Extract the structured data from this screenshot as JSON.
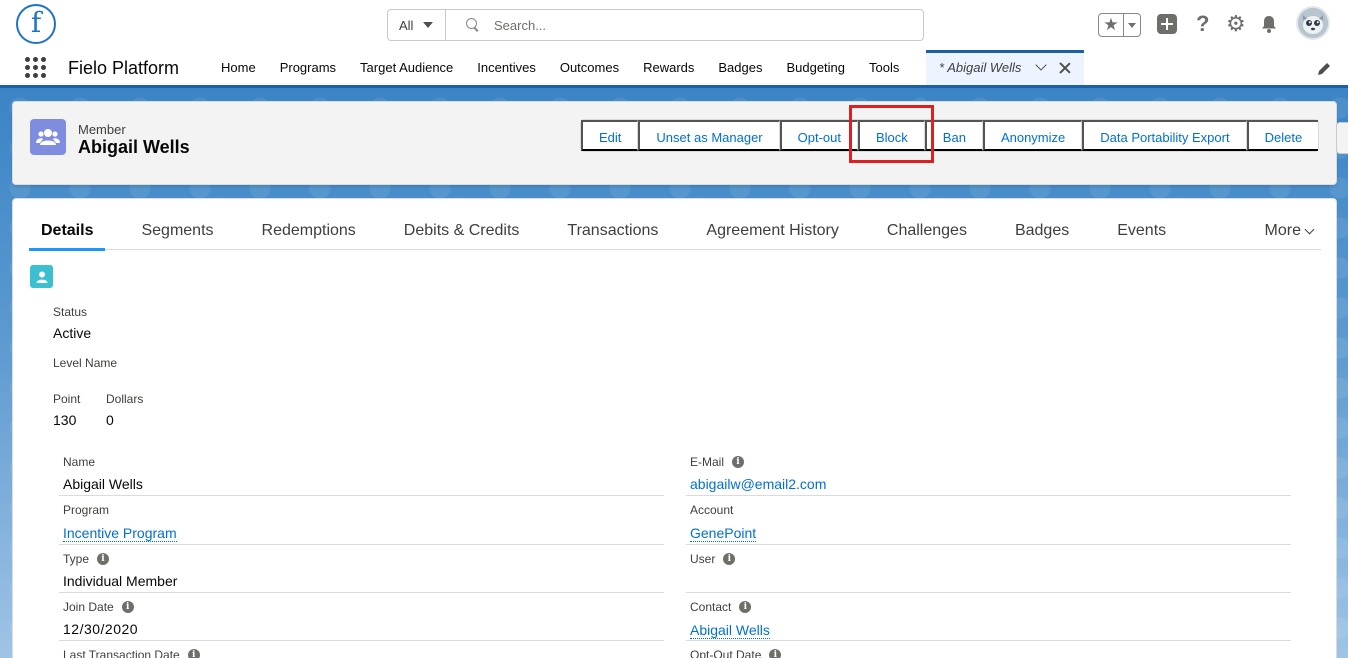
{
  "header": {
    "logo_letter": "f",
    "search": {
      "scope": "All",
      "placeholder": "Search..."
    },
    "icons": [
      "favorites-star-icon",
      "add-icon",
      "help-icon",
      "gear-icon",
      "bell-icon",
      "avatar"
    ]
  },
  "nav": {
    "app_name": "Fielo Platform",
    "items": [
      "Home",
      "Programs",
      "Target Audience",
      "Incentives",
      "Outcomes",
      "Rewards",
      "Badges",
      "Budgeting",
      "Tools"
    ],
    "active_tab": "* Abigail Wells"
  },
  "record": {
    "type": "Member",
    "title": "Abigail Wells",
    "actions": [
      "Edit",
      "Unset as Manager",
      "Opt-out",
      "Block",
      "Ban",
      "Anonymize",
      "Data Portability Export",
      "Delete"
    ]
  },
  "tabs": {
    "items": [
      "Details",
      "Segments",
      "Redemptions",
      "Debits & Credits",
      "Transactions",
      "Agreement History",
      "Challenges",
      "Badges",
      "Events"
    ],
    "more": "More",
    "active": "Details"
  },
  "highlights": {
    "status_label": "Status",
    "status_value": "Active",
    "level_label": "Level Name",
    "point_label": "Point",
    "point_value": "130",
    "dollars_label": "Dollars",
    "dollars_value": "0"
  },
  "fields": {
    "name_label": "Name",
    "name_value": "Abigail Wells",
    "email_label": "E-Mail",
    "email_value": "abigailw@email2.com",
    "program_label": "Program",
    "program_value": "Incentive Program",
    "account_label": "Account",
    "account_value": "GenePoint",
    "type_label": "Type",
    "type_value": "Individual Member",
    "user_label": "User",
    "join_label": "Join Date",
    "join_value": "12/30/2020",
    "contact_label": "Contact",
    "contact_value": "Abigail Wells",
    "last_tx_label": "Last Transaction Date",
    "optout_label": "Opt-Out Date"
  },
  "colors": {
    "brand_blue": "#0070d2",
    "highlight_red": "#e02020",
    "record_icon": "#7f8de1",
    "contact_icon": "#3bbfd1"
  }
}
